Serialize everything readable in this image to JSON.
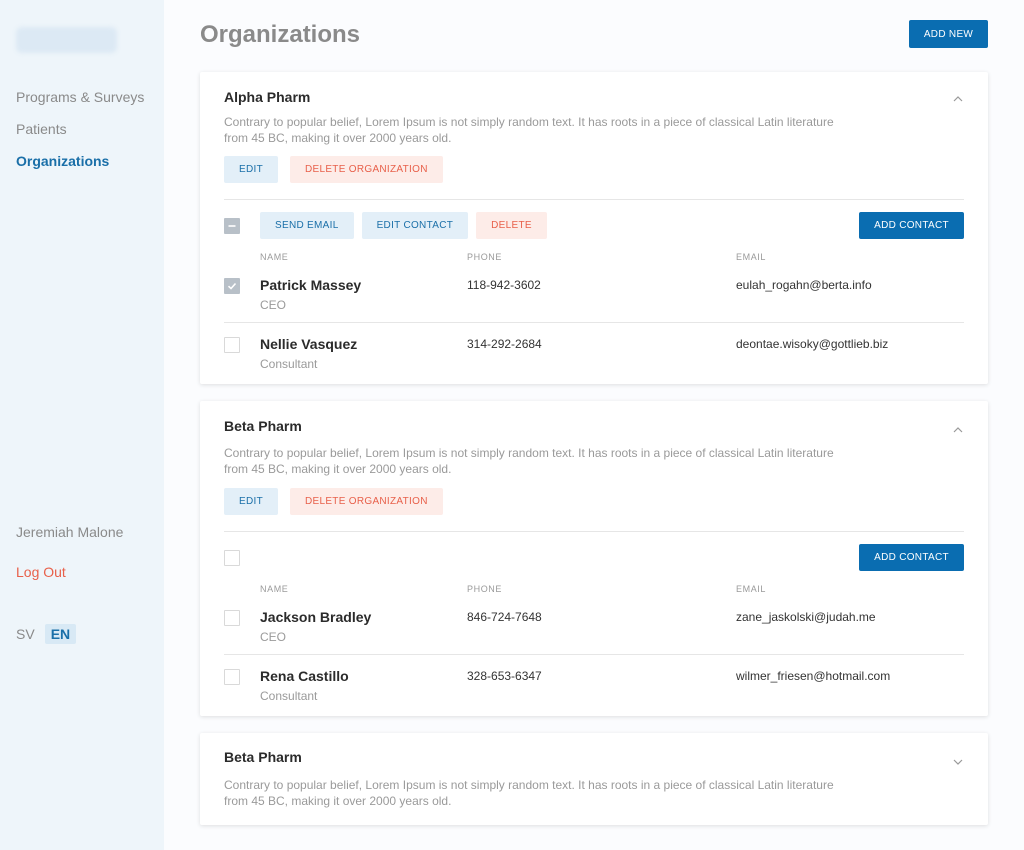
{
  "sidebar": {
    "nav": [
      {
        "label": "Programs & Surveys",
        "active": false
      },
      {
        "label": "Patients",
        "active": false
      },
      {
        "label": "Organizations",
        "active": true
      }
    ],
    "user_name": "Jeremiah Malone",
    "logout_label": "Log Out",
    "languages": [
      {
        "label": "SV",
        "active": false
      },
      {
        "label": "EN",
        "active": true
      }
    ]
  },
  "header": {
    "title": "Organizations",
    "add_new_label": "ADD NEW"
  },
  "colors": {
    "primary": "#0a6db1",
    "active_nav": "#1a6fa8",
    "danger": "#e8604a",
    "sidebar_bg": "#eef5fa"
  },
  "organizations": [
    {
      "name": "Alpha Pharm",
      "description": "Contrary to popular belief, Lorem Ipsum is not simply random text. It has roots in a piece of classical Latin literature from 45 BC, making it over 2000 years old.",
      "expanded": true,
      "edit_label": "EDIT",
      "delete_label": "DELETE ORGANIZATION",
      "toolbar": {
        "select_state": "indeterminate",
        "send_email_label": "SEND EMAIL",
        "edit_contact_label": "EDIT CONTACT",
        "delete_label": "DELETE",
        "add_contact_label": "ADD CONTACT"
      },
      "columns": {
        "name": "NAME",
        "phone": "PHONE",
        "email": "EMAIL"
      },
      "contacts": [
        {
          "name": "Patrick Massey",
          "role": "CEO",
          "phone": "118-942-3602",
          "email": "eulah_rogahn@berta.info",
          "checked": true
        },
        {
          "name": "Nellie Vasquez",
          "role": "Consultant",
          "phone": "314-292-2684",
          "email": "deontae.wisoky@gottlieb.biz",
          "checked": false
        }
      ]
    },
    {
      "name": "Beta Pharm",
      "description": "Contrary to popular belief, Lorem Ipsum is not simply random text. It has roots in a piece of classical Latin literature from 45 BC, making it over 2000 years old.",
      "expanded": true,
      "edit_label": "EDIT",
      "delete_label": "DELETE ORGANIZATION",
      "toolbar": {
        "select_state": "unchecked",
        "add_contact_label": "ADD CONTACT"
      },
      "columns": {
        "name": "NAME",
        "phone": "PHONE",
        "email": "EMAIL"
      },
      "contacts": [
        {
          "name": "Jackson Bradley",
          "role": "CEO",
          "phone": "846-724-7648",
          "email": "zane_jaskolski@judah.me",
          "checked": false
        },
        {
          "name": "Rena Castillo",
          "role": "Consultant",
          "phone": "328-653-6347",
          "email": "wilmer_friesen@hotmail.com",
          "checked": false
        }
      ]
    },
    {
      "name": "Beta Pharm",
      "description": "Contrary to popular belief, Lorem Ipsum is not simply random text. It has roots in a piece of classical Latin literature from 45 BC, making it over 2000 years old.",
      "expanded": false
    }
  ]
}
